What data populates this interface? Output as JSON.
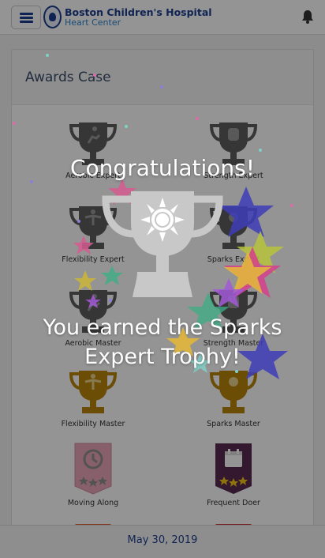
{
  "header": {
    "brand_name": "Boston Children's Hospital",
    "brand_sub": "Heart Center"
  },
  "card": {
    "title": "Awards Case"
  },
  "awards": [
    {
      "label": "Aerobic Expert",
      "icon": "runner-trophy-icon",
      "earned": false
    },
    {
      "label": "Strength Expert",
      "icon": "fist-trophy-icon",
      "earned": false
    },
    {
      "label": "Flexibility Expert",
      "icon": "stretch-trophy-icon",
      "earned": false
    },
    {
      "label": "Sparks Expert",
      "icon": "sun-trophy-icon",
      "earned": true
    },
    {
      "label": "Aerobic Master",
      "icon": "runner-trophy-icon",
      "earned": false
    },
    {
      "label": "Strength Master",
      "icon": "fist-trophy-icon",
      "earned": false
    },
    {
      "label": "Flexibility Master",
      "icon": "stretch-gold-trophy-icon",
      "earned": true
    },
    {
      "label": "Sparks Master",
      "icon": "sun-gold-trophy-icon",
      "earned": true
    },
    {
      "label": "Moving Along",
      "icon": "clock-badge-icon",
      "earned": false
    },
    {
      "label": "Frequent Doer",
      "icon": "calendar-badge-icon",
      "earned": true
    }
  ],
  "footer": {
    "date": "May 30, 2019"
  },
  "overlay": {
    "headline": "Congratulations!",
    "message": "You earned the Sparks Expert Trophy!"
  },
  "colors": {
    "brand_navy": "#1d3f8f",
    "brand_blue": "#2d84c9",
    "trophy_gray": "#5e5e5e",
    "trophy_gold": "#b8860b",
    "badge_pink": "#e8a6b8",
    "badge_purple": "#5a2a52"
  }
}
